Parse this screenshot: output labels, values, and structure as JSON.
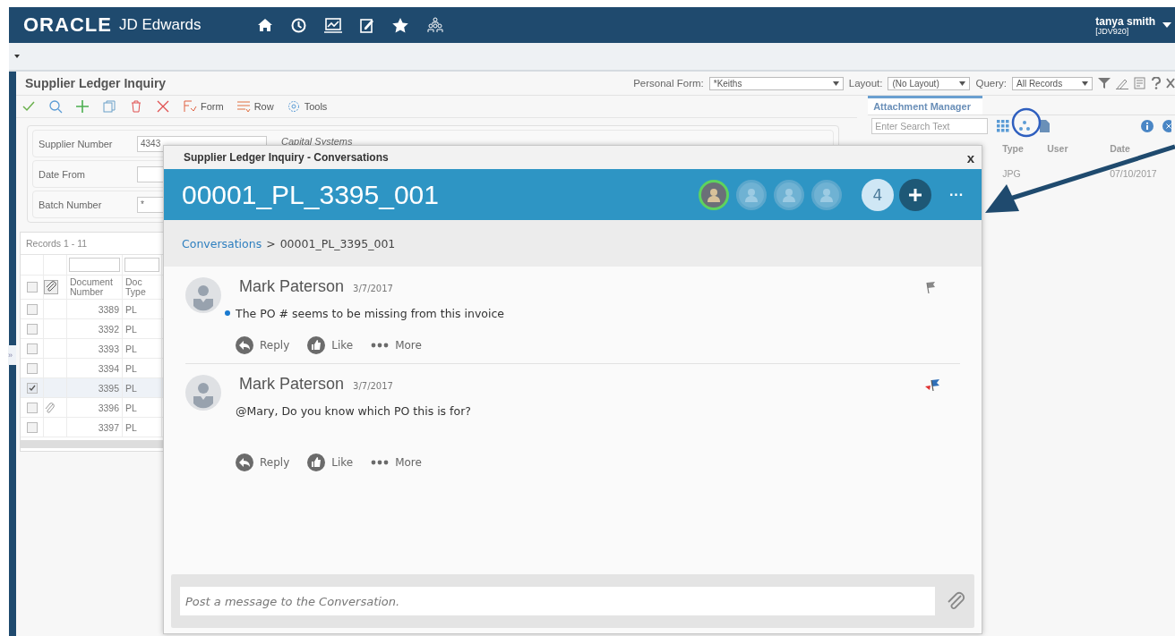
{
  "header": {
    "brand": "ORACLE",
    "product": "JD Edwards",
    "user_name": "tanya smith",
    "environment": "[JDV920]"
  },
  "form": {
    "title": "Supplier Ledger Inquiry",
    "selectors": [
      {
        "label": "Personal Form:",
        "value": "*Keiths"
      },
      {
        "label": "Layout:",
        "value": "(No Layout)"
      },
      {
        "label": "Query:",
        "value": "All Records"
      }
    ],
    "toolbar": [
      {
        "kind": "check"
      },
      {
        "kind": "search"
      },
      {
        "kind": "add"
      },
      {
        "kind": "copy"
      },
      {
        "kind": "delete"
      },
      {
        "kind": "close"
      },
      {
        "kind": "form",
        "label": "Form"
      },
      {
        "kind": "row",
        "label": "Row"
      },
      {
        "kind": "tools",
        "label": "Tools"
      }
    ],
    "fields": [
      {
        "label": "Supplier Number",
        "value": "4343",
        "description": "Capital Systems"
      },
      {
        "label": "Date From"
      },
      {
        "label": "Batch Number",
        "value": "*"
      }
    ],
    "grid": {
      "records": "Records 1 - 11",
      "all_checked": false,
      "expand_tab": "»",
      "columns": [
        "Document Number",
        "Doc Type"
      ],
      "rows": [
        {
          "number": "3389",
          "type": "PL",
          "selected": false,
          "attachment": false
        },
        {
          "number": "3392",
          "type": "PL",
          "selected": false,
          "attachment": false
        },
        {
          "number": "3393",
          "type": "PL",
          "selected": false,
          "attachment": false
        },
        {
          "number": "3394",
          "type": "PL",
          "selected": false,
          "attachment": false
        },
        {
          "number": "3395",
          "type": "PL",
          "selected": true,
          "attachment": false
        },
        {
          "number": "3396",
          "type": "PL",
          "selected": false,
          "attachment": true
        },
        {
          "number": "3397",
          "type": "PL",
          "selected": false,
          "attachment": false
        }
      ]
    }
  },
  "attachment_manager": {
    "title": "Attachment Manager",
    "search_placeholder": "Enter Search Text",
    "columns": [
      "Type",
      "User",
      "Date"
    ],
    "rows": [
      {
        "type": "JPG",
        "date": "07/10/2017"
      }
    ]
  },
  "conversation": {
    "window_title": "Supplier Ledger Inquiry - Conversations",
    "close": "x",
    "heading": "00001_PL_3395_001",
    "participants": [
      {
        "active": true
      },
      {
        "active": false
      },
      {
        "active": false
      },
      {
        "active": false
      }
    ],
    "participant_count": "4",
    "more": "···",
    "breadcrumb": {
      "link": "Conversations",
      "separator": ">",
      "current": "00001_PL_3395_001"
    },
    "messages": [
      {
        "author": "Mark Paterson",
        "date": "3/7/2017",
        "text": "The PO # seems to be missing from this invoice",
        "unread": true,
        "flagged": false,
        "actions": [
          "Reply",
          "Like",
          "More"
        ]
      },
      {
        "author": "Mark Paterson",
        "date": "3/7/2017",
        "text": "@Mary, Do you know which PO this is for?",
        "unread": false,
        "flagged": true,
        "actions": [
          "Reply",
          "Like",
          "More"
        ]
      }
    ],
    "composer_placeholder": "Post a message to the Conversation."
  }
}
